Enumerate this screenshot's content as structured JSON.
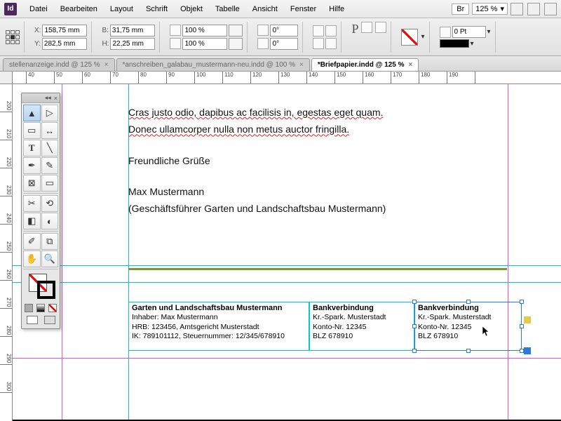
{
  "app": {
    "id_label": "Id"
  },
  "menu": [
    "Datei",
    "Bearbeiten",
    "Layout",
    "Schrift",
    "Objekt",
    "Tabelle",
    "Ansicht",
    "Fenster",
    "Hilfe"
  ],
  "menu_right": {
    "br": "Br",
    "zoom": "125 %"
  },
  "control": {
    "x": "158,75 mm",
    "y": "282,5 mm",
    "w": "31,75 mm",
    "h": "22,25 mm",
    "scale_x": "100 %",
    "scale_y": "100 %",
    "rotate": "0°",
    "shear": "0°",
    "stroke_weight": "0 Pt"
  },
  "tabs": [
    {
      "title": "stellenanzeige.indd @ 125 %",
      "active": false
    },
    {
      "title": "*anschreiben_galabau_mustermann-neu.indd @ 100 %",
      "active": false
    },
    {
      "title": "*Briefpapier.indd @ 125 %",
      "active": true
    }
  ],
  "ruler_h": [
    "40",
    "50",
    "60",
    "70",
    "80",
    "90",
    "100",
    "110",
    "120",
    "130",
    "140",
    "150",
    "160",
    "170",
    "180",
    "190"
  ],
  "ruler_v": [
    "200",
    "210",
    "220",
    "230",
    "240",
    "250",
    "260",
    "270",
    "280",
    "290",
    "300"
  ],
  "body": {
    "l1": "Cras justo odio, dapibus ac facilisis in, egestas eget quam.",
    "l2": "Donec ullamcorper nulla non metus auctor fringilla.",
    "l3": "Freundliche Grüße",
    "l4": "Max Mustermann",
    "l5": "(Geschäftsführer Garten und Landschaftsbau Mustermann)"
  },
  "footer": {
    "box1": {
      "title": "Garten und Landschaftsbau Mustermann",
      "r1": "Inhaber: Max Mustermann",
      "r2": "HRB: 123456, Amtsgericht Musterstadt",
      "r3": "IK: 789101112, Steuernummer: 12/345/678910"
    },
    "box2": {
      "title": "Bankverbindung",
      "r1": "Kr.-Spark. Musterstadt",
      "r2": "Konto-Nr. 12345",
      "r3": "BLZ 678910"
    },
    "box3": {
      "title": "Bankverbindung",
      "r1": "Kr.-Spark. Musterstadt",
      "r2": "Konto-Nr. 12345",
      "r3": "BLZ 678910"
    }
  }
}
